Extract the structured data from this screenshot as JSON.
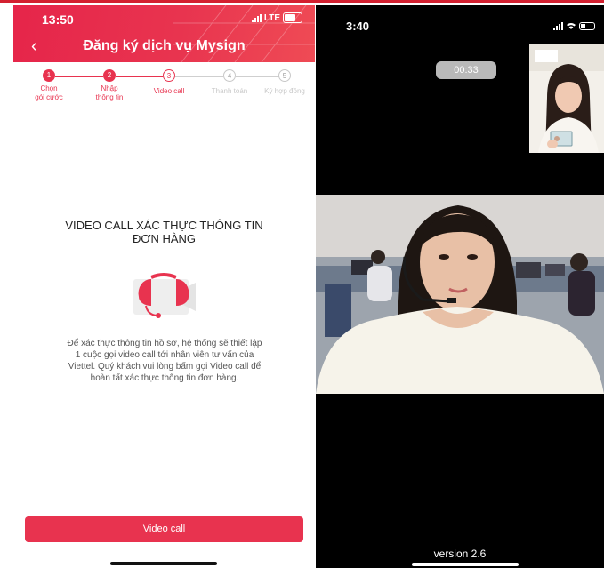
{
  "left_phone": {
    "status": {
      "time": "13:50",
      "network": "LTE"
    },
    "header": {
      "back_icon": "chevron-left-icon",
      "title": "Đăng ký dịch vụ Mysign"
    },
    "steps": [
      {
        "number": "1",
        "label": "Chọn\ngói cước",
        "state": "done"
      },
      {
        "number": "2",
        "label": "Nhập\nthông tin",
        "state": "done"
      },
      {
        "number": "3",
        "label": "Video call",
        "state": "current"
      },
      {
        "number": "4",
        "label": "Thanh toán",
        "state": "todo"
      },
      {
        "number": "5",
        "label": "Ký hợp đồng",
        "state": "todo"
      }
    ],
    "heading": "VIDEO CALL XÁC THỰC THÔNG TIN\nĐƠN HÀNG",
    "illustration_icon": "video-call-icon",
    "description": "Để xác thực thông tin hồ sơ, hệ thống sẽ thiết lập 1 cuộc gọi video call tới nhân viên tư vấn của Viettel. Quý khách vui lòng bấm gọi Video call để hoàn tất xác thực thông tin đơn hàng.",
    "button_label": "Video call",
    "colors": {
      "accent": "#e8334f"
    }
  },
  "right_phone": {
    "status": {
      "time": "3:40"
    },
    "call_timer": "00:33",
    "version": "version 2.6"
  }
}
